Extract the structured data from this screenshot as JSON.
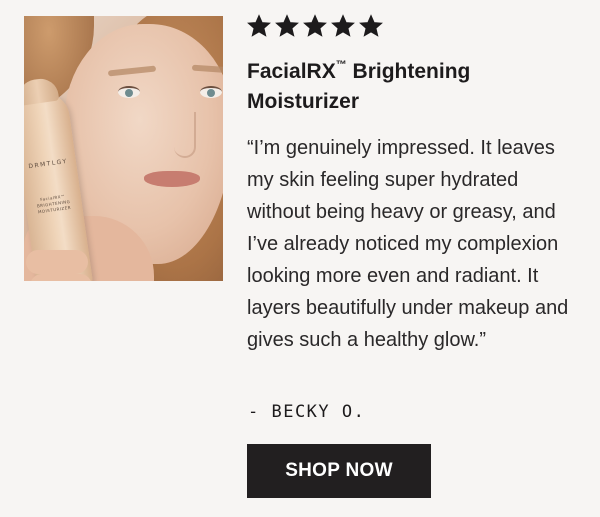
{
  "product_image": {
    "bottle": {
      "brand": "DRMTLGY",
      "lines": [
        "FacialRX™",
        "BRIGHTENING",
        "MOISTURIZER"
      ]
    }
  },
  "review": {
    "rating": 5,
    "max_rating": 5,
    "star_color": "#1d1b1c",
    "title_main": "FacialRX",
    "title_mark": "™",
    "title_rest": " Brightening Moisturizer",
    "quote": "“I’m genuinely impressed. It leaves my skin feeling super hydrated without being heavy or greasy, and I’ve already noticed my complexion looking more even and radiant. It layers beautifully under makeup and gives such a healthy glow.”",
    "author": "- BECKY O."
  },
  "cta": {
    "shop_label": "SHOP NOW",
    "background": "#221f20"
  }
}
